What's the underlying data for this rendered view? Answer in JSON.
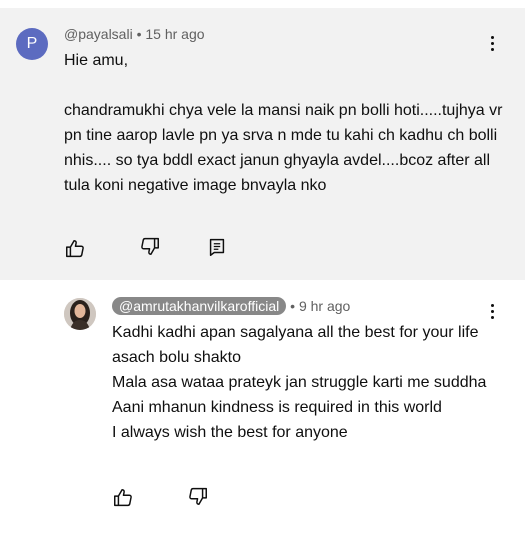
{
  "comment": {
    "avatar_letter": "P",
    "avatar_color": "#5c6bc0",
    "handle": "@payalsali",
    "separator": "•",
    "time": "15 hr ago",
    "lines": [
      "Hie amu,",
      "",
      " chandramukhi chya vele la mansi naik pn bolli hoti.....tujhya vr pn tine aarop lavle pn ya srva n mde tu kahi ch kadhu ch bolli nhis.... so tya bddl exact janun ghyayla avdel....bcoz after all tula koni negative image bnvayla nko"
    ],
    "icons": [
      "like-icon",
      "dislike-icon",
      "reply-icon",
      "more-vert-icon"
    ]
  },
  "reply": {
    "handle": "@amrutakhanvilkarofficial",
    "separator": "•",
    "time": "9 hr ago",
    "lines": [
      "Kadhi kadhi apan sagalyana all the best for your life asach bolu shakto",
      "Mala asa wataa prateyk jan struggle karti me suddha",
      "Aani mhanun kindness is required in this world",
      "I always wish the best for anyone"
    ],
    "icons": [
      "like-icon",
      "dislike-icon",
      "more-vert-icon"
    ]
  }
}
